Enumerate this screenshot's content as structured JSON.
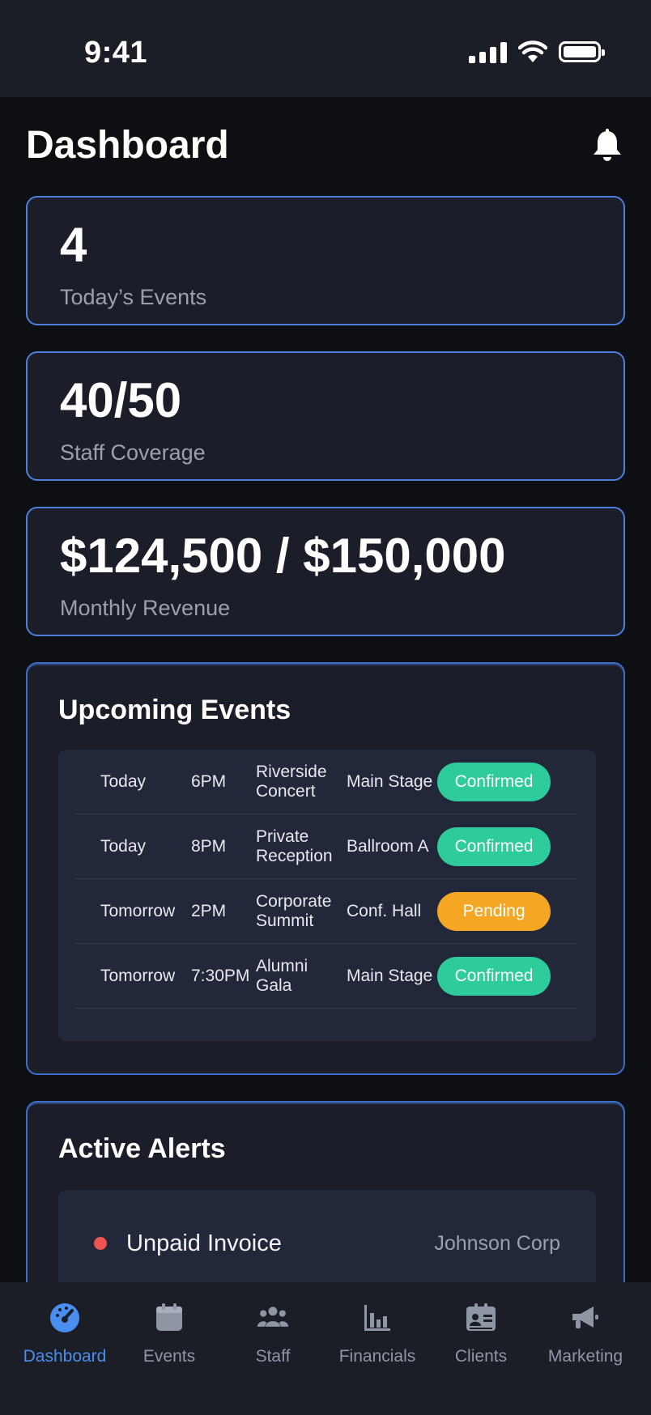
{
  "status_bar": {
    "time": "9:41"
  },
  "header": {
    "title": "Dashboard"
  },
  "stats": [
    {
      "value": "4",
      "label": "Today’s Events"
    },
    {
      "value": "40/50",
      "label": "Staff Coverage"
    },
    {
      "value": "$124,500 / $150,000",
      "label": "Monthly Revenue"
    }
  ],
  "upcoming": {
    "title": "Upcoming Events",
    "rows": [
      {
        "day": "Today",
        "time": "6PM",
        "name": "Riverside Concert",
        "location": "Main Stage",
        "status": "Confirmed"
      },
      {
        "day": "Today",
        "time": "8PM",
        "name": "Private Reception",
        "location": "Ballroom A",
        "status": "Confirmed"
      },
      {
        "day": "Tomorrow",
        "time": "2PM",
        "name": "Corporate Summit",
        "location": "Conf. Hall",
        "status": "Pending"
      },
      {
        "day": "Tomorrow",
        "time": "7:30PM",
        "name": "Alumni Gala",
        "location": "Main Stage",
        "status": "Confirmed"
      }
    ]
  },
  "alerts": {
    "title": "Active Alerts",
    "items": [
      {
        "title": "Unpaid Invoice",
        "client": "Johnson Corp"
      }
    ]
  },
  "tabs": [
    {
      "label": "Dashboard",
      "icon": "dashboard-icon"
    },
    {
      "label": "Events",
      "icon": "calendar-icon"
    },
    {
      "label": "Staff",
      "icon": "users-icon"
    },
    {
      "label": "Financials",
      "icon": "chart-icon"
    },
    {
      "label": "Clients",
      "icon": "contact-card-icon"
    },
    {
      "label": "Marketing",
      "icon": "megaphone-icon"
    }
  ],
  "colors": {
    "accent": "#4a8ef0",
    "confirmed": "#2ecc9a",
    "pending": "#f5a623",
    "alert": "#ef5350"
  }
}
